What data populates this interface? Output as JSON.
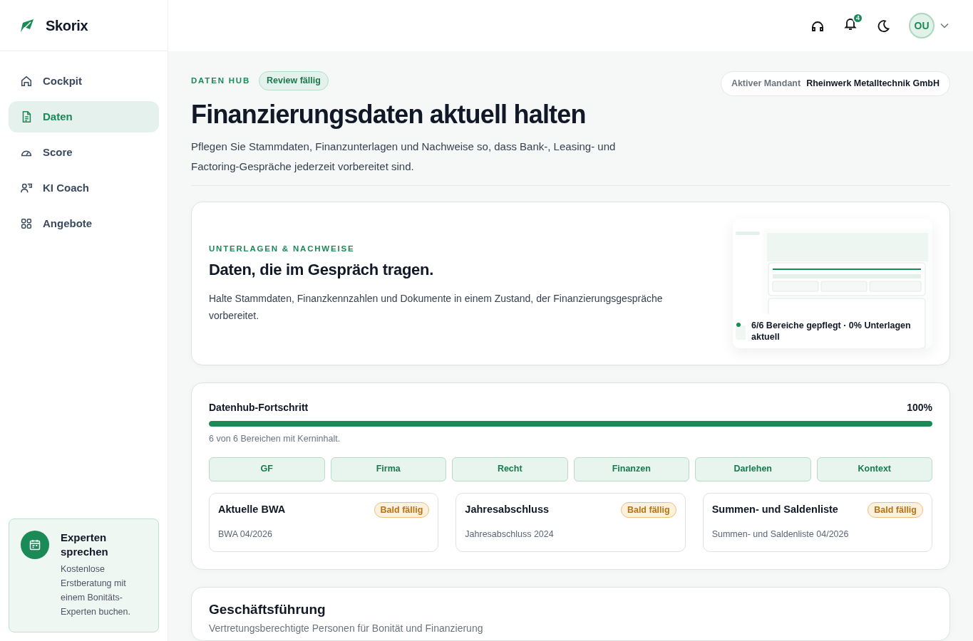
{
  "brand": "Skorix",
  "sidebar": {
    "items": [
      {
        "label": "Cockpit",
        "selected": false
      },
      {
        "label": "Daten",
        "selected": true
      },
      {
        "label": "Score",
        "selected": false
      },
      {
        "label": "KI Coach",
        "selected": false
      },
      {
        "label": "Angebote",
        "selected": false
      }
    ],
    "promo": {
      "title": "Experten sprechen",
      "text": "Kostenlose Erstberatung mit einem Bonitäts-Experten buchen."
    }
  },
  "topbar": {
    "notification_count": "4",
    "avatar": "OU"
  },
  "header": {
    "eyebrow": "DATEN HUB",
    "badge": "Review fällig",
    "title": "Finanzierungsdaten aktuell halten",
    "description": "Pflegen Sie Stammdaten, Finanzunterlagen und Nachweise so, dass Bank-, Leasing- und Factoring-Gespräche jederzeit vorbereitet sind.",
    "client_label": "Aktiver Mandant",
    "client_name": "Rheinwerk Metalltechnik GmbH"
  },
  "hero": {
    "eyebrow": "UNTERLAGEN & NACHWEISE",
    "title": "Daten, die im Gespräch tragen.",
    "text": "Halte Stammdaten, Finanzkennzahlen und Dokumente in einem Zustand, der Finanzierungsgespräche vorbereitet.",
    "preview_caption": "6/6 Bereiche gepflegt · 0% Unterlagen aktuell"
  },
  "progress": {
    "title": "Datenhub-Fortschritt",
    "percent": "100%",
    "level": 1.0,
    "note": "6 von 6 Bereichen mit Kerninhalt.",
    "sections": [
      "GF",
      "Firma",
      "Recht",
      "Finanzen",
      "Darlehen",
      "Kontext"
    ],
    "documents": [
      {
        "title": "Aktuelle BWA",
        "status": "Bald fällig",
        "detail": "BWA 04/2026"
      },
      {
        "title": "Jahresabschluss",
        "status": "Bald fällig",
        "detail": "Jahresabschluss 2024"
      },
      {
        "title": "Summen- und Saldenliste",
        "status": "Bald fällig",
        "detail": "Summen- und Saldenliste 04/2026"
      }
    ]
  },
  "management": {
    "title": "Geschäftsführung",
    "subtitle": "Vertretungsberechtigte Personen für Bonität und Finanzierung"
  }
}
